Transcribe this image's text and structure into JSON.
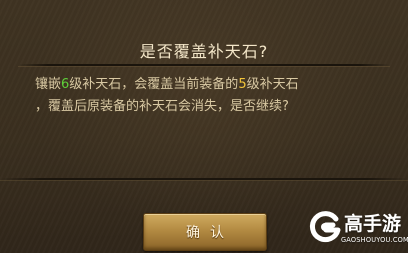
{
  "dialog": {
    "title": "是否覆盖补天石?",
    "message": {
      "part1": "镶嵌",
      "new_level": "6",
      "part2": "级补天石，会覆盖当前装备的",
      "current_level": "5",
      "part3": "级补天石",
      "part4": "，覆盖后原装备的补天石会消失，是否继续?"
    },
    "confirm_label": "确认"
  },
  "watermark": {
    "name": "高手游",
    "url": "GAOSHOUYOU.COM"
  },
  "colors": {
    "background": "#3a2f1f",
    "title_text": "#f3e6c8",
    "body_text": "#d9c9a3",
    "highlight_new_level": "#5fd03a",
    "highlight_current_level": "#f3c53a",
    "button_gold": "#b38a42"
  }
}
